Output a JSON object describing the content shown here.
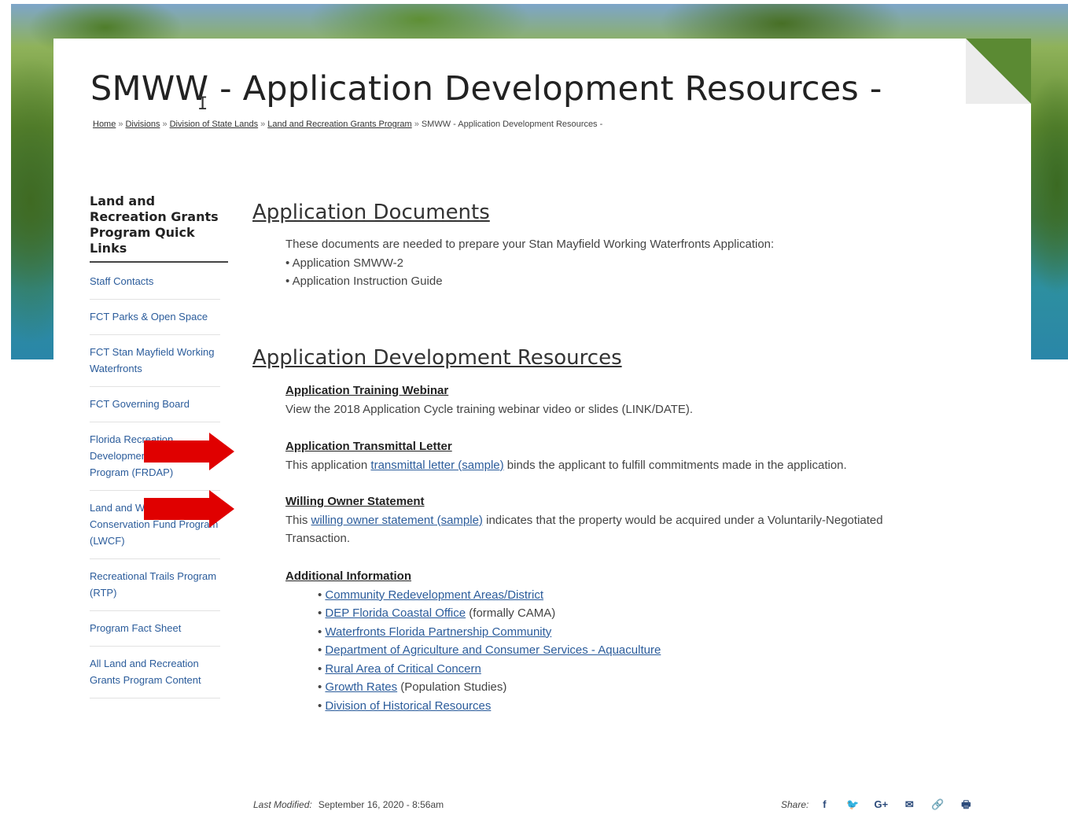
{
  "page": {
    "title": "SMWW - Application Development Resources -"
  },
  "breadcrumb": [
    {
      "label": "Home"
    },
    {
      "label": "Divisions"
    },
    {
      "label": "Division of State Lands"
    },
    {
      "label": "Land and Recreation Grants Program"
    },
    {
      "label": "SMWW - Application Development Resources -"
    }
  ],
  "breadcrumb_separator": "»",
  "sidebar": {
    "title": "Land and Recreation Grants Program Quick Links",
    "items": [
      {
        "label": "Staff Contacts"
      },
      {
        "label": "FCT Parks & Open Space"
      },
      {
        "label": "FCT Stan Mayfield Working Waterfronts"
      },
      {
        "label": "FCT Governing Board"
      },
      {
        "label": "Florida Recreation Development Assistance Program (FRDAP)"
      },
      {
        "label": "Land and Water Conservation Fund Program (LWCF)"
      },
      {
        "label": "Recreational Trails Program (RTP)"
      },
      {
        "label": "Program Fact Sheet"
      },
      {
        "label": "All Land and Recreation Grants Program Content"
      }
    ]
  },
  "documents": {
    "heading": "Application Documents",
    "intro": "These documents are needed to prepare your Stan Mayfield Working Waterfronts Application:",
    "items": [
      "• Application SMWW-2",
      "• Application Instruction Guide"
    ]
  },
  "resources": {
    "heading": "Application Development Resources",
    "webinar": {
      "title": "Application Training Webinar",
      "text": "View the 2018 Application Cycle training webinar video or slides (LINK/DATE)."
    },
    "transmittal": {
      "title": "Application Transmittal Letter",
      "before": "This application ",
      "link": "transmittal letter (sample)",
      "after": " binds the applicant to fulfill commitments made in the application."
    },
    "owner": {
      "title": "Willing Owner Statement",
      "before": "This ",
      "link": "willing owner statement (sample)",
      "after": " indicates that the property would be acquired under a Voluntarily-Negotiated",
      "line2": "Transaction."
    },
    "additional": {
      "title": "Additional Information",
      "items": [
        {
          "bullet": "• ",
          "link": "Community Redevelopment Areas/District",
          "suffix": ""
        },
        {
          "bullet": "• ",
          "link": "DEP Florida Coastal Office",
          "suffix": " (formally CAMA)"
        },
        {
          "bullet": "• ",
          "link": "Waterfronts Florida Partnership Community",
          "suffix": ""
        },
        {
          "bullet": "• ",
          "link": "Department of Agriculture and Consumer Services - Aquaculture",
          "suffix": ""
        },
        {
          "bullet": "• ",
          "link": "Rural Area of Critical Concern",
          "suffix": ""
        },
        {
          "bullet": "• ",
          "link": "Growth Rates",
          "suffix": " (Population Studies)"
        },
        {
          "bullet": "• ",
          "link": "Division of Historical Resources",
          "suffix": ""
        }
      ]
    }
  },
  "footer": {
    "modified_label": "Last Modified:",
    "modified_value": "September 16, 2020 - 8:56am",
    "share_label": "Share:",
    "share_icons": [
      "facebook-icon",
      "twitter-icon",
      "google-plus-icon",
      "email-icon",
      "link-icon",
      "print-icon"
    ],
    "share_glyphs": [
      "f",
      "🐦",
      "G+",
      "✉",
      "🔗",
      "🖶"
    ]
  },
  "colors": {
    "link": "#2b5c9b",
    "arrow": "#e00000"
  }
}
